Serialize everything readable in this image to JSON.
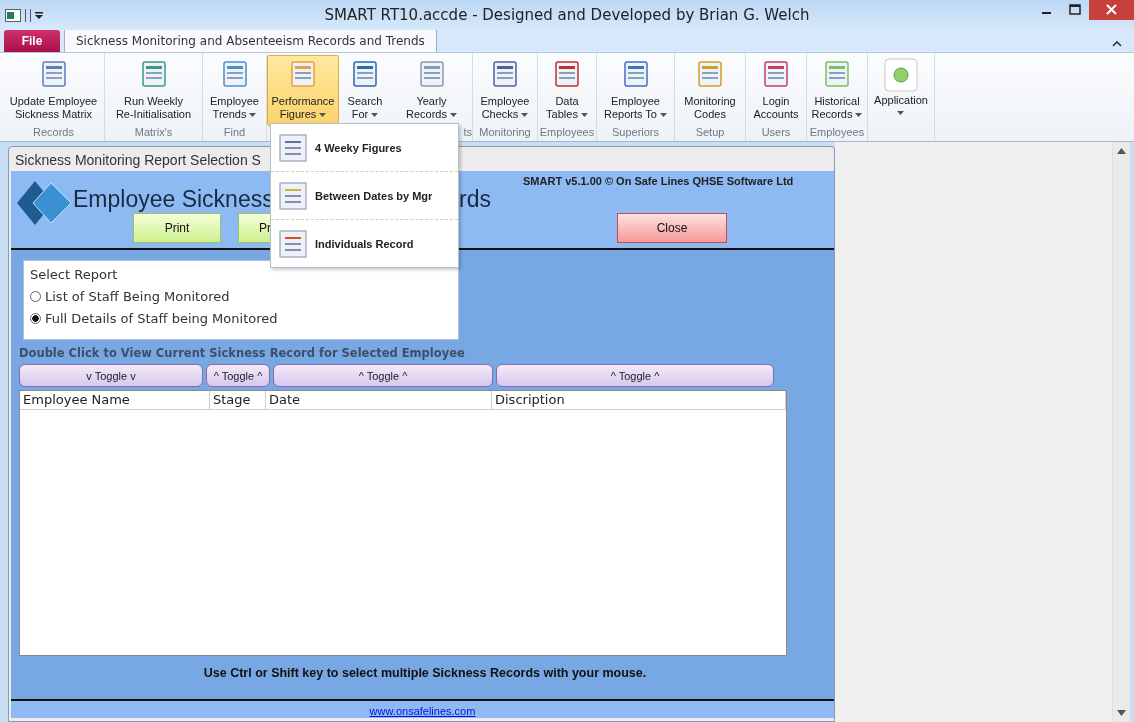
{
  "window": {
    "title": "SMART RT10.accde - Designed and Developed by Brian G. Welch"
  },
  "file_tab": "File",
  "tabs": [
    {
      "label": "Sickness Monitoring and Absenteeism Records and Trends",
      "selected": true
    }
  ],
  "ribbon_groups": [
    {
      "label": "Records",
      "buttons": [
        {
          "lines": [
            "Update Employee",
            "Sickness Matrix"
          ],
          "dropdown": false,
          "selected": false
        }
      ]
    },
    {
      "label": "Matrix's",
      "buttons": [
        {
          "lines": [
            "Run Weekly",
            "Re-Initialisation"
          ],
          "dropdown": false,
          "selected": false
        }
      ]
    },
    {
      "label": "Find",
      "buttons": [
        {
          "lines": [
            "Employee",
            "Trends"
          ],
          "dropdown": true,
          "selected": false
        }
      ]
    },
    {
      "label": "ts",
      "buttons": [
        {
          "lines": [
            "Performance",
            "Figures"
          ],
          "dropdown": true,
          "selected": true
        },
        {
          "lines": [
            "Search",
            "For"
          ],
          "dropdown": true,
          "selected": false
        },
        {
          "lines": [
            "Yearly",
            "Records"
          ],
          "dropdown": true,
          "selected": false
        }
      ]
    },
    {
      "label": "Monitoring",
      "buttons": [
        {
          "lines": [
            "Employee",
            "Checks"
          ],
          "dropdown": true,
          "selected": false
        }
      ]
    },
    {
      "label": "Employees",
      "buttons": [
        {
          "lines": [
            "Data",
            "Tables"
          ],
          "dropdown": true,
          "selected": false
        }
      ]
    },
    {
      "label": "Superiors",
      "buttons": [
        {
          "lines": [
            "Employee",
            "Reports To"
          ],
          "dropdown": true,
          "selected": false
        }
      ]
    },
    {
      "label": "Setup",
      "buttons": [
        {
          "lines": [
            "Monitoring",
            "Codes"
          ],
          "dropdown": false,
          "selected": false
        }
      ]
    },
    {
      "label": "Users",
      "buttons": [
        {
          "lines": [
            "Login",
            "Accounts"
          ],
          "dropdown": false,
          "selected": false
        }
      ]
    },
    {
      "label": "Employees",
      "buttons": [
        {
          "lines": [
            "Historical",
            "Records"
          ],
          "dropdown": true,
          "selected": false
        }
      ]
    },
    {
      "buttons": [
        {
          "lines": [
            "Application"
          ],
          "dropdown": true,
          "selected": false
        }
      ]
    }
  ],
  "menu": {
    "items": [
      "4 Weeky Figures",
      "Between Dates by Mgr",
      "Individuals Record"
    ]
  },
  "form": {
    "title": "Sickness Monitoring Report Selection S",
    "heading_left": "Employee Sickness",
    "heading_right": "rds",
    "copyright": "SMART v5.1.00 © On Safe Lines QHSE Software Ltd",
    "buttons": [
      {
        "label": "Print",
        "kind": "print"
      },
      {
        "label": "Pr",
        "kind": "print"
      },
      {
        "label": "Close",
        "kind": "close"
      }
    ],
    "select_report": {
      "label": "Select Report",
      "options": [
        {
          "label": "List of Staff Being Monitored",
          "selected": false
        },
        {
          "label": "Full Details of Staff being Monitored",
          "selected": true
        }
      ]
    },
    "instruction": "Double Click to View Current Sickness Record for Selected Employee",
    "toggles": [
      "v Toggle v",
      "^ Toggle ^",
      "^ Toggle ^",
      "^ Toggle ^"
    ],
    "table": {
      "columns": [
        "Employee Name",
        "Stage",
        "Date",
        "Discription"
      ]
    },
    "hint": "Use Ctrl or Shift key to select multiple Sickness Records with your mouse.",
    "link": "www.onsafelines.com"
  }
}
